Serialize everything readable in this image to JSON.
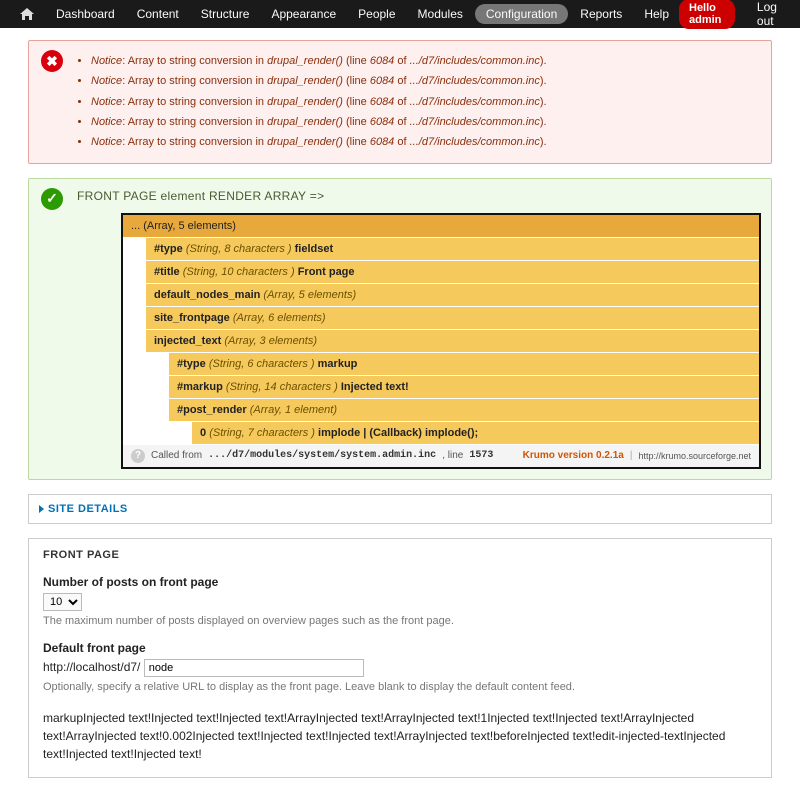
{
  "toolbar": {
    "items": [
      {
        "label": "Dashboard"
      },
      {
        "label": "Content"
      },
      {
        "label": "Structure"
      },
      {
        "label": "Appearance"
      },
      {
        "label": "People"
      },
      {
        "label": "Modules"
      },
      {
        "label": "Configuration",
        "active": true
      },
      {
        "label": "Reports"
      },
      {
        "label": "Help"
      }
    ],
    "hello": "Hello admin",
    "logout": "Log out"
  },
  "errors": {
    "items": [
      {
        "prefix": "Notice",
        "msg": ": Array to string conversion in ",
        "fn": "drupal_render()",
        "line_label": " (line ",
        "line": "6084",
        "of_label": " of ",
        "path": ".../d7/includes/common.inc",
        "suffix": ")."
      },
      {
        "prefix": "Notice",
        "msg": ": Array to string conversion in ",
        "fn": "drupal_render()",
        "line_label": " (line ",
        "line": "6084",
        "of_label": " of ",
        "path": ".../d7/includes/common.inc",
        "suffix": ")."
      },
      {
        "prefix": "Notice",
        "msg": ": Array to string conversion in ",
        "fn": "drupal_render()",
        "line_label": " (line ",
        "line": "6084",
        "of_label": " of ",
        "path": ".../d7/includes/common.inc",
        "suffix": ")."
      },
      {
        "prefix": "Notice",
        "msg": ": Array to string conversion in ",
        "fn": "drupal_render()",
        "line_label": " (line ",
        "line": "6084",
        "of_label": " of ",
        "path": ".../d7/includes/common.inc",
        "suffix": ")."
      },
      {
        "prefix": "Notice",
        "msg": ": Array to string conversion in ",
        "fn": "drupal_render()",
        "line_label": " (line ",
        "line": "6084",
        "of_label": " of ",
        "path": ".../d7/includes/common.inc",
        "suffix": ")."
      }
    ]
  },
  "status": {
    "heading": "FRONT PAGE element RENDER ARRAY =>",
    "krumo": {
      "root": "... (Array, 5 elements)",
      "rows": [
        {
          "key": "#type",
          "type": "(String, 8 characters )",
          "val": "fieldset"
        },
        {
          "key": "#title",
          "type": "(String, 10 characters )",
          "val": "Front page"
        },
        {
          "key": "default_nodes_main",
          "type": "(Array, 5 elements)",
          "val": ""
        },
        {
          "key": "site_frontpage",
          "type": "(Array, 6 elements)",
          "val": ""
        },
        {
          "key": "injected_text",
          "type": "(Array, 3 elements)",
          "val": ""
        }
      ],
      "nested": [
        {
          "key": "#type",
          "type": "(String, 6 characters )",
          "val": "markup"
        },
        {
          "key": "#markup",
          "type": "(String, 14 characters )",
          "val": "Injected text!"
        },
        {
          "key": "#post_render",
          "type": "(Array, 1 element)",
          "val": ""
        }
      ],
      "deep": {
        "key": "0",
        "type": "(String, 7 characters )",
        "val": "implode | (Callback) implode();"
      },
      "footer": {
        "called": "Called from ",
        "path": ".../d7/modules/system/system.admin.inc",
        "line_prefix": ", line ",
        "line": "1573",
        "version": "Krumo version 0.2.1a",
        "url": "http://krumo.sourceforge.net"
      }
    }
  },
  "fieldsets": {
    "site_details": {
      "legend": "SITE DETAILS"
    },
    "front_page": {
      "legend": "FRONT PAGE",
      "posts": {
        "label": "Number of posts on front page",
        "value": "10",
        "desc": "The maximum number of posts displayed on overview pages such as the front page."
      },
      "default_front": {
        "label": "Default front page",
        "prefix": "http://localhost/d7/",
        "value": "node",
        "desc": "Optionally, specify a relative URL to display as the front page. Leave blank to display the default content feed."
      },
      "injected": "markupInjected text!Injected text!Injected text!ArrayInjected text!ArrayInjected text!1Injected text!Injected text!ArrayInjected text!ArrayInjected text!0.002Injected text!Injected text!Injected text!ArrayInjected text!beforeInjected text!edit-injected-textInjected text!Injected text!Injected text!"
    }
  }
}
